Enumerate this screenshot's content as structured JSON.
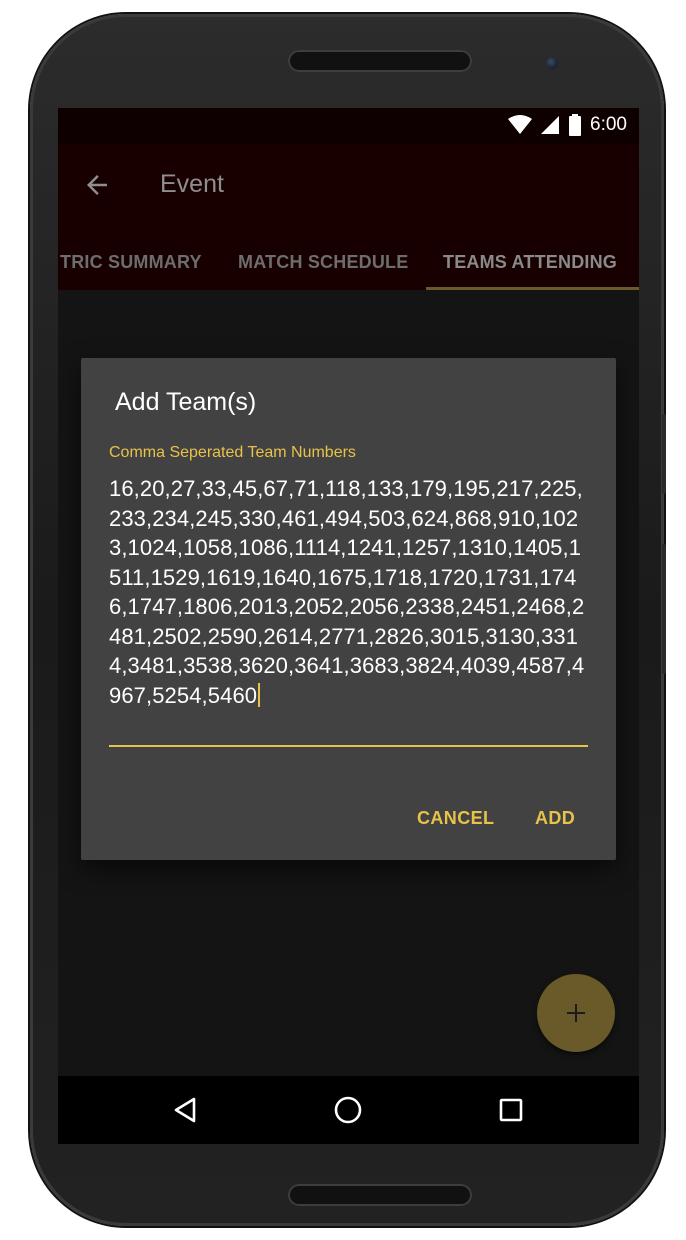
{
  "status_bar": {
    "time": "6:00",
    "icons": [
      "wifi-icon",
      "cellular-signal-icon",
      "battery-icon"
    ]
  },
  "app_bar": {
    "title": "Event",
    "back_icon": "arrow-back-icon",
    "tabs": [
      {
        "label": "TRIC SUMMARY",
        "active": false
      },
      {
        "label": "MATCH SCHEDULE",
        "active": false
      },
      {
        "label": "TEAMS ATTENDING",
        "active": true
      }
    ]
  },
  "dialog": {
    "title": "Add Team(s)",
    "field_label": "Comma Seperated Team Numbers",
    "field_value": "16,20,27,33,45,67,71,118,133,179,195,217,225,233,234,245,330,461,494,503,624,868,910,1023,1024,1058,1086,1114,1241,1257,1310,1405,1511,1529,1619,1640,1675,1718,1720,1731,1746,1747,1806,2013,2052,2056,2338,2451,2468,2481,2502,2590,2614,2771,2826,3015,3130,3314,3481,3538,3620,3641,3683,3824,4039,4587,4967,5254,5460",
    "cancel_label": "CANCEL",
    "add_label": "ADD"
  },
  "fab": {
    "icon": "plus-icon",
    "label": "+"
  },
  "nav_bar": {
    "icons": [
      "back-triangle-icon",
      "home-circle-icon",
      "recents-square-icon"
    ]
  },
  "colors": {
    "accent": "#e8c24a",
    "dialog_bg": "#424242",
    "app_bar_bg": "#180000",
    "fab_bg": "#6b5a29"
  }
}
